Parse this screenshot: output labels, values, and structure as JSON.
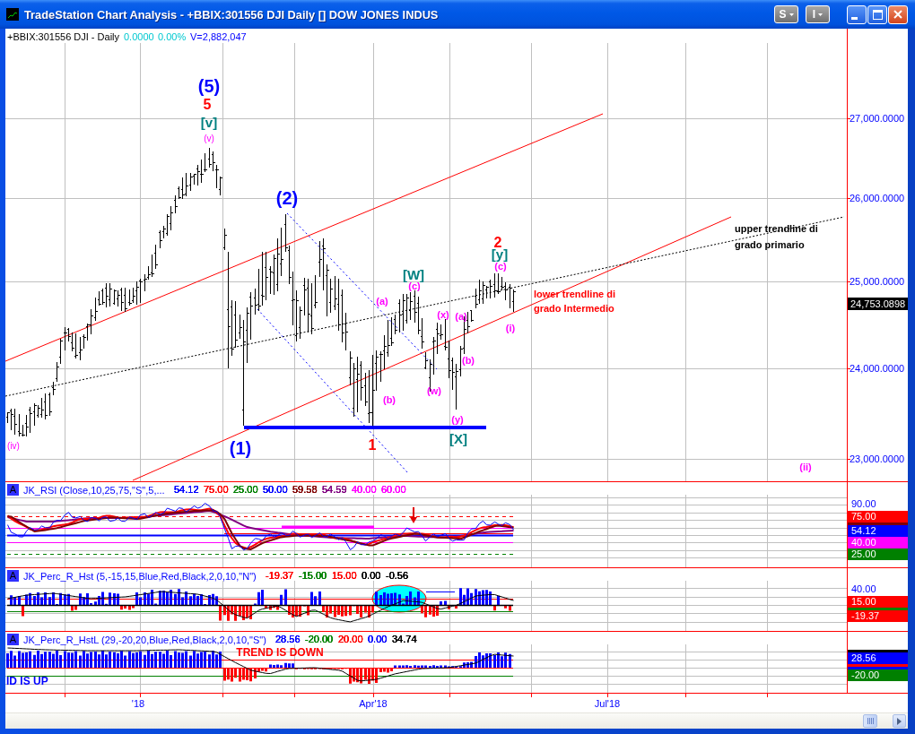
{
  "window": {
    "title": "TradeStation Chart Analysis - +BBIX:301556 DJI Daily [] DOW JONES INDUS",
    "menu_buttons": [
      "S",
      "I"
    ]
  },
  "chart": {
    "symbol": "+BBIX:301556 DJI - Daily",
    "change": "0.0000",
    "change_percent": "0.00%",
    "volume": "V=2,882,047",
    "price_axis": [
      "27,000.0000",
      "26,000.0000",
      "25,000.0000",
      "24,000.0000",
      "23,000.0000"
    ],
    "last_price": "24,753.0898",
    "wave_labels": [
      {
        "text": "(5)",
        "kind": "primary"
      },
      {
        "text": "5",
        "kind": "intermediate"
      },
      {
        "text": "[v]",
        "kind": "minor"
      },
      {
        "text": "(v)",
        "kind": "subminute"
      },
      {
        "text": "(iv)",
        "kind": "subminute"
      },
      {
        "text": "(2)",
        "kind": "primary"
      },
      {
        "text": "(1)",
        "kind": "primary"
      },
      {
        "text": "1",
        "kind": "intermediate"
      },
      {
        "text": "(a)",
        "kind": "minute"
      },
      {
        "text": "(b)",
        "kind": "minute"
      },
      {
        "text": "[W]",
        "kind": "minor"
      },
      {
        "text": "(c)",
        "kind": "minute"
      },
      {
        "text": "(w)",
        "kind": "minute"
      },
      {
        "text": "(x)",
        "kind": "minute"
      },
      {
        "text": "(a)",
        "kind": "minute"
      },
      {
        "text": "(b)",
        "kind": "minute"
      },
      {
        "text": "(y)",
        "kind": "minute"
      },
      {
        "text": "[X]",
        "kind": "minor"
      },
      {
        "text": "2",
        "kind": "intermediate"
      },
      {
        "text": "[y]",
        "kind": "minor"
      },
      {
        "text": "(c)",
        "kind": "minute"
      },
      {
        "text": "(i)",
        "kind": "minute"
      },
      {
        "text": "(ii)",
        "kind": "minute"
      }
    ],
    "trendline_notes": [
      {
        "lines": [
          "upper trendline di",
          "grado primario"
        ],
        "kind": "primary"
      },
      {
        "lines": [
          "lower trendline di",
          "grado Intermedio"
        ],
        "kind": "intermediate"
      }
    ]
  },
  "studies": [
    {
      "kind": "rsi",
      "tag": "A",
      "name": "JK_RSI (Close,10,25,75,\"S\",5,...",
      "values": [
        {
          "text": "54.12",
          "color": "#0000ff"
        },
        {
          "text": "75.00",
          "color": "#ff0000"
        },
        {
          "text": "25.00",
          "color": "#008000"
        },
        {
          "text": "50.00",
          "color": "#0000ff"
        },
        {
          "text": "59.58",
          "color": "#800000"
        },
        {
          "text": "54.59",
          "color": "#800080"
        },
        {
          "text": "40.00",
          "color": "#ff00ff"
        },
        {
          "text": "60.00",
          "color": "#ff00ff"
        }
      ],
      "axis": [
        {
          "text": "90.00"
        },
        {
          "text": "75.00",
          "color": "#ff0000"
        },
        {
          "color": "#800000"
        },
        {
          "text": "54.12",
          "color": "#0000ff"
        },
        {
          "text": "40.00",
          "color": "#ff00ff"
        },
        {
          "text": "25.00",
          "color": "#008000"
        }
      ]
    },
    {
      "kind": "histogram",
      "tag": "A",
      "name": "JK_Perc_R_Hst (5,-15,15,Blue,Red,Black,2,0,10,\"N\")",
      "values": [
        {
          "text": "-19.37",
          "color": "#ff0000"
        },
        {
          "text": "-15.00",
          "color": "#008000"
        },
        {
          "text": "15.00",
          "color": "#ff0000"
        },
        {
          "text": "0.00",
          "color": "#000000"
        },
        {
          "text": "-0.56",
          "color": "#000000"
        }
      ],
      "axis": [
        {
          "text": "40.00"
        },
        {
          "text": "15.00",
          "color": "#ff0000"
        },
        {
          "color": "#008000"
        },
        {
          "text": "-19.37",
          "color": "#ff0000"
        }
      ]
    },
    {
      "kind": "trend_histogram",
      "tag": "A",
      "name": "JK_Perc_R_HstL (29,-20,20,Blue,Red,Black,2,0,10,\"S\")",
      "values": [
        {
          "text": "28.56",
          "color": "#0000ff"
        },
        {
          "text": "-20.00",
          "color": "#008000"
        },
        {
          "text": "20.00",
          "color": "#ff0000"
        },
        {
          "text": "0.00",
          "color": "#0000ff"
        },
        {
          "text": "34.74",
          "color": "#000000"
        }
      ],
      "axis": [
        {
          "color": "#000000"
        },
        {
          "text": "28.56",
          "color": "#0000ff"
        },
        {
          "color": "#ff0000"
        },
        {
          "color": "#0000ff"
        },
        {
          "text": "-20.00",
          "color": "#008000"
        }
      ],
      "notes": [
        {
          "text": "TREND IS DOWN",
          "kind": "down"
        },
        {
          "text": "ID IS UP",
          "kind": "up"
        }
      ]
    }
  ],
  "time_axis": [
    "'18",
    "Apr'18",
    "Jul'18"
  ]
}
